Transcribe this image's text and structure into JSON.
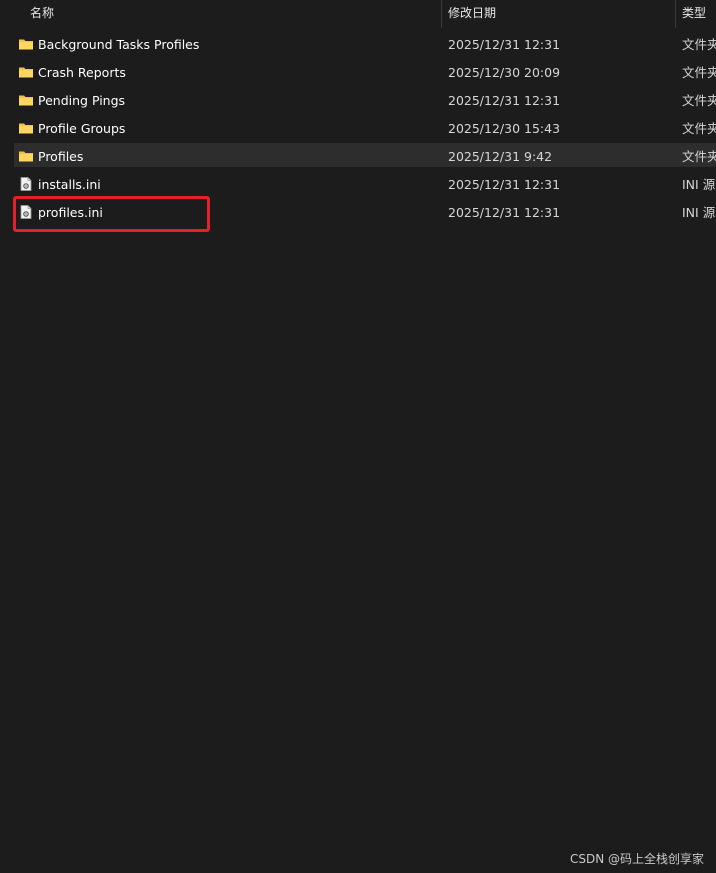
{
  "header": {
    "name_label": "名称",
    "date_label": "修改日期",
    "type_label": "类型",
    "sort_indicator": "^"
  },
  "rows": [
    {
      "name": "Background Tasks Profiles",
      "date": "2025/12/31 12:31",
      "type": "文件夹",
      "icon": "folder-icon"
    },
    {
      "name": "Crash Reports",
      "date": "2025/12/30 20:09",
      "type": "文件夹",
      "icon": "folder-icon"
    },
    {
      "name": "Pending Pings",
      "date": "2025/12/31 12:31",
      "type": "文件夹",
      "icon": "folder-icon"
    },
    {
      "name": "Profile Groups",
      "date": "2025/12/30 15:43",
      "type": "文件夹",
      "icon": "folder-icon"
    },
    {
      "name": "Profiles",
      "date": "2025/12/31 9:42",
      "type": "文件夹",
      "icon": "folder-icon",
      "selected": true
    },
    {
      "name": "installs.ini",
      "date": "2025/12/31 12:31",
      "type": "INI 源",
      "icon": "ini-file-icon"
    },
    {
      "name": "profiles.ini",
      "date": "2025/12/31 12:31",
      "type": "INI 源",
      "icon": "ini-file-icon"
    }
  ],
  "watermark": "CSDN @码上全栈创享家",
  "colors": {
    "background": "#1c1c1c",
    "folder": "#f4c242",
    "selected_row": "#2d2d2d",
    "highlight": "#e3202b"
  }
}
